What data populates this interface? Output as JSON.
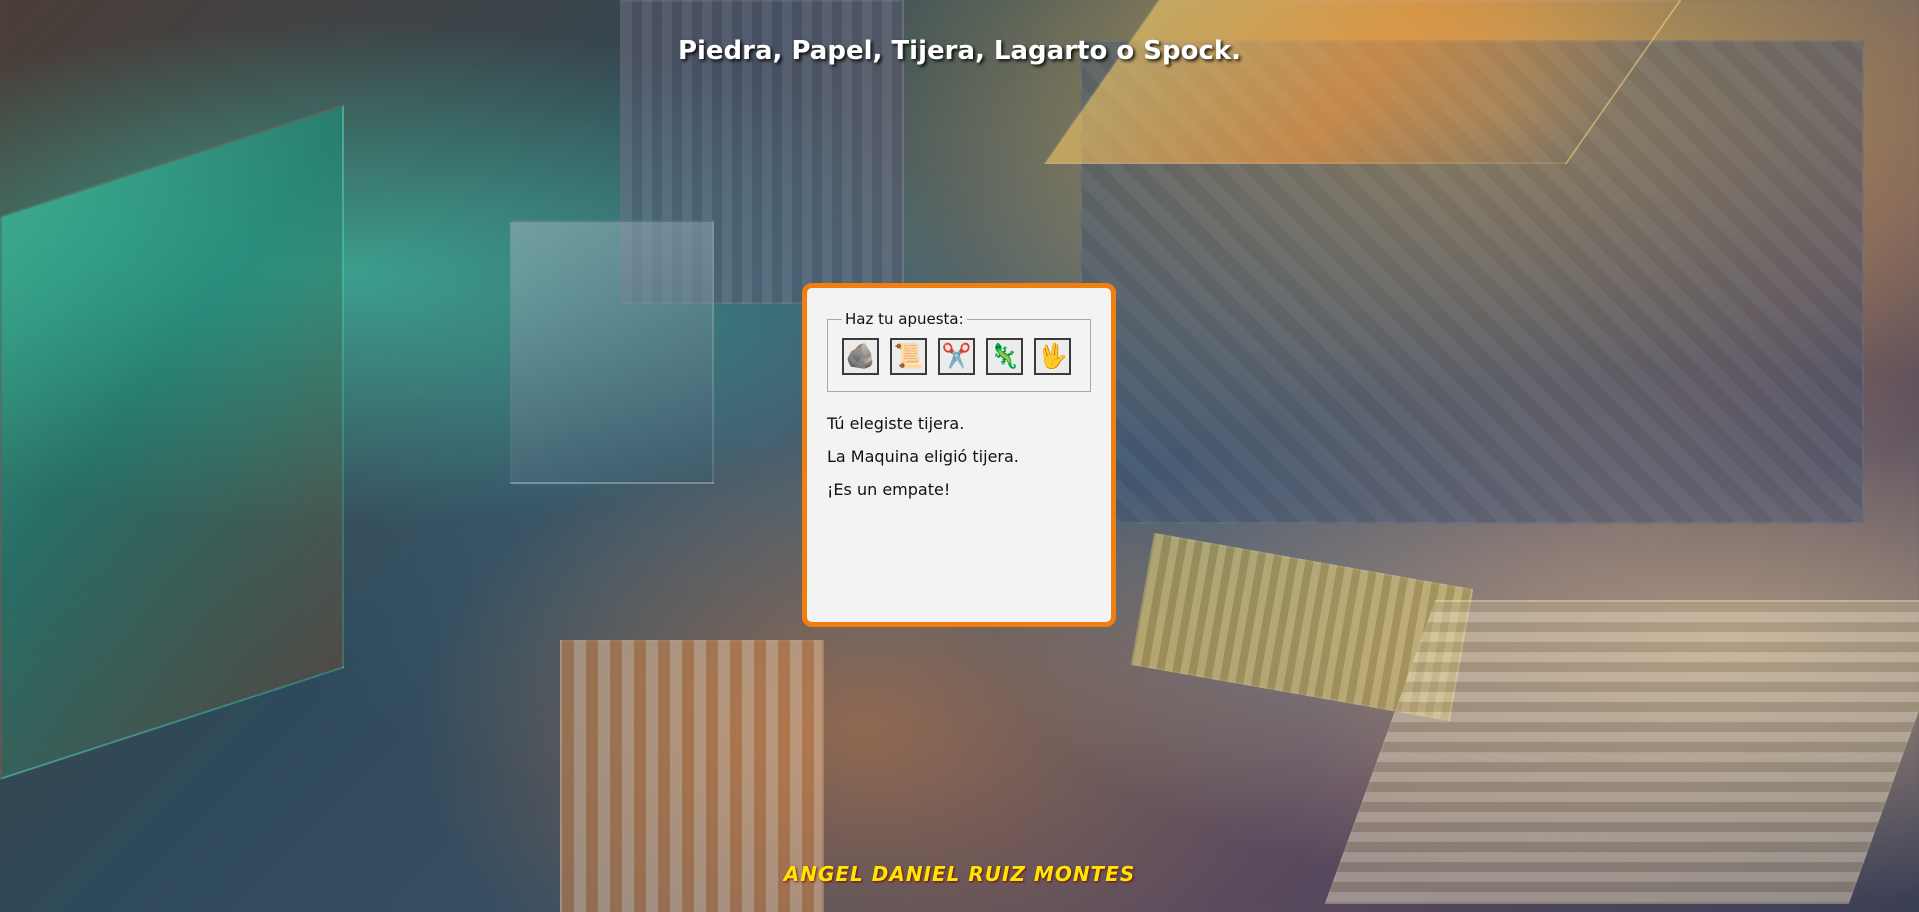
{
  "page": {
    "title": "Piedra, Papel, Tijera, Lagarto o Spock.",
    "background_accent": "#f07f10"
  },
  "game": {
    "legend": "Haz tu apuesta:",
    "choices": [
      {
        "name": "piedra",
        "icon": "rock-icon",
        "glyph": "🪨"
      },
      {
        "name": "papel",
        "icon": "paper-scroll-icon",
        "glyph": "📜"
      },
      {
        "name": "tijera",
        "icon": "scissors-icon",
        "glyph": "✂️"
      },
      {
        "name": "lagarto",
        "icon": "lizard-icon",
        "glyph": "🦎"
      },
      {
        "name": "spock",
        "icon": "vulcan-salute-icon",
        "glyph": "🖖"
      }
    ],
    "result_player": "Tú elegiste tijera.",
    "result_machine": "La Maquina eligió tijera.",
    "result_outcome": "¡Es un empate!"
  },
  "footer": {
    "signature": "ANGEL DANIEL RUIZ MONTES",
    "signature_color": "#ffe600"
  }
}
